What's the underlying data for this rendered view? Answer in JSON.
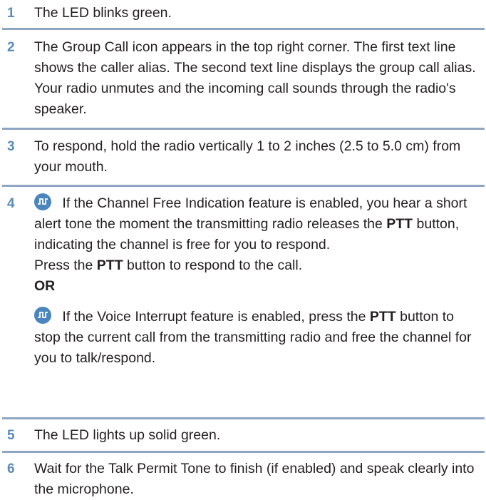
{
  "steps": [
    {
      "num": "1",
      "text": "The LED blinks green."
    },
    {
      "num": "2",
      "text": "The Group Call icon appears in the top right corner. The first text line shows the caller alias. The second text line displays the group call alias. Your radio unmutes and the incoming call sounds through the radio's speaker."
    },
    {
      "num": "3",
      "text": "To respond, hold the radio vertically 1 to 2 inches (2.5 to 5.0 cm) from your mouth."
    },
    {
      "num": "4",
      "para1_a": " If the Channel Free Indication feature is enabled, you hear a short alert tone the moment the transmitting radio releases the ",
      "para1_bold": "PTT",
      "para1_b": " button, indicating the channel is free for you to respond.",
      "para2_a": "Press the ",
      "para2_bold": "PTT",
      "para2_b": " button to respond to the call.",
      "or": "OR",
      "para3_a": " If the Voice Interrupt feature is enabled, press the ",
      "para3_bold": "PTT",
      "para3_b": " button to stop the current call from the transmitting radio and free the channel for you to talk/respond."
    },
    {
      "num": "5",
      "text": "The LED lights up solid green."
    },
    {
      "num": "6",
      "text": "Wait for the Talk Permit Tone to finish (if enabled) and speak clearly into the microphone."
    }
  ],
  "icons": {
    "feature_icon": "feature-icon"
  },
  "colors": {
    "step_number": "#5b8bb8",
    "rule": "#8ea6c2",
    "feature_icon": "#4a86bd"
  }
}
